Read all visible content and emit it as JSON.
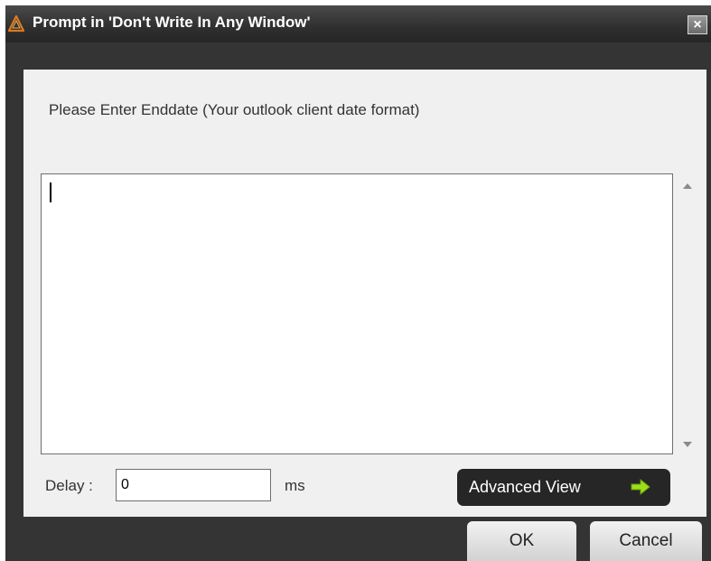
{
  "window": {
    "title": "Prompt in 'Don't Write In Any Window'",
    "close_icon": "×",
    "app_icon": "warning-triangle-icon"
  },
  "prompt": {
    "label": "Please Enter Enddate (Your outlook client date format)",
    "value": ""
  },
  "delay": {
    "label": "Delay :",
    "value": "0",
    "unit": "ms"
  },
  "advanced_view": {
    "label": "Advanced View",
    "icon": "arrow-right-icon",
    "icon_color": "#9fdc1a"
  },
  "buttons": {
    "ok": "OK",
    "cancel": "Cancel"
  }
}
